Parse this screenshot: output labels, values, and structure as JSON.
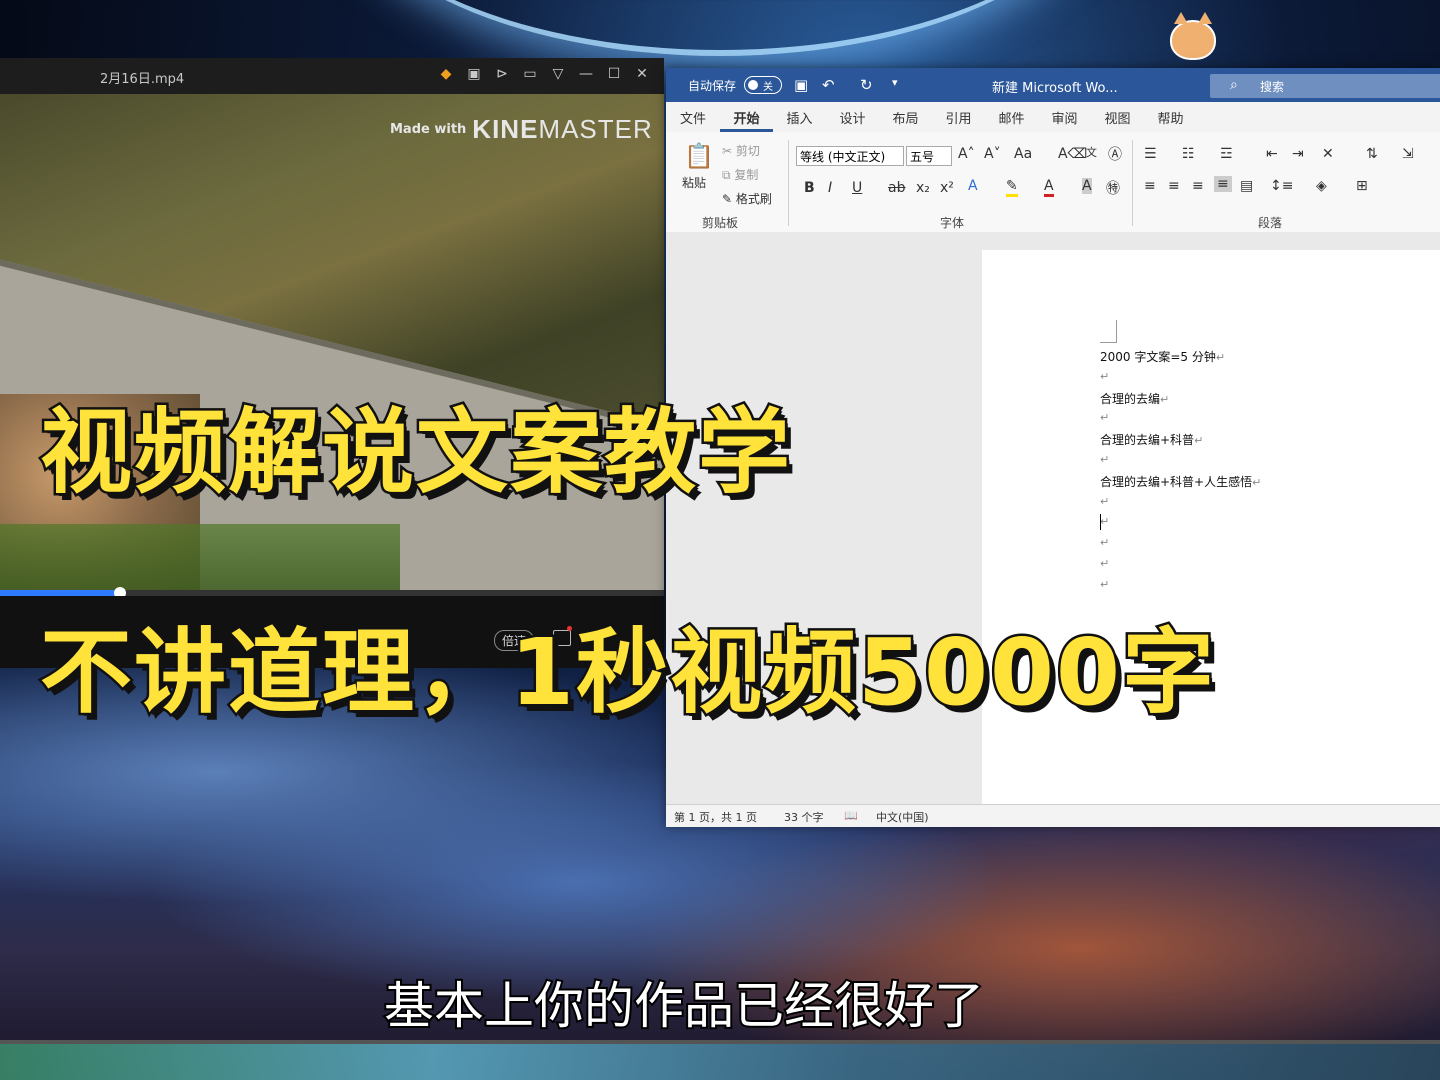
{
  "player": {
    "title": "2月16日.mp4",
    "icons": [
      "game-icon",
      "window-icon",
      "pin-icon",
      "folder-icon",
      "collapse-icon",
      "minimize-icon",
      "maximize-icon",
      "close-icon"
    ],
    "watermark_small": "Made with",
    "watermark_kine": "KINE",
    "watermark_master": "MASTER",
    "speed_label": "倍速",
    "progress_fraction": 0.18
  },
  "word": {
    "autosave_label": "自动保存",
    "autosave_state": "关",
    "doc_title": "新建 Microsoft Wo...",
    "search_placeholder": "搜索",
    "tabs": [
      "文件",
      "开始",
      "插入",
      "设计",
      "布局",
      "引用",
      "邮件",
      "审阅",
      "视图",
      "帮助"
    ],
    "active_tab": "开始",
    "clipboard": {
      "paste": "粘贴",
      "cut": "剪切",
      "copy": "复制",
      "format_painter": "格式刷",
      "group_label": "剪贴板"
    },
    "font": {
      "font_name": "等线 (中文正文)",
      "font_size": "五号",
      "group_label": "字体"
    },
    "paragraph": {
      "group_label": "段落"
    },
    "document_lines": [
      "2000 字文案=5 分钟",
      "",
      "合理的去编",
      "",
      "合理的去编+科普",
      "",
      "合理的去编+科普+人生感悟",
      "",
      "",
      "",
      "",
      ""
    ],
    "status": {
      "page": "第 1 页，共 1 页",
      "words": "33 个字",
      "language": "中文(中国)"
    }
  },
  "overlay": {
    "headline_1": "视频解说文案教学",
    "headline_2": "不讲道理，1秒视频5000字",
    "subtitle": "基本上你的作品已经很好了"
  },
  "colors": {
    "headline": "#ffe23a",
    "word_blue": "#2b579a"
  }
}
